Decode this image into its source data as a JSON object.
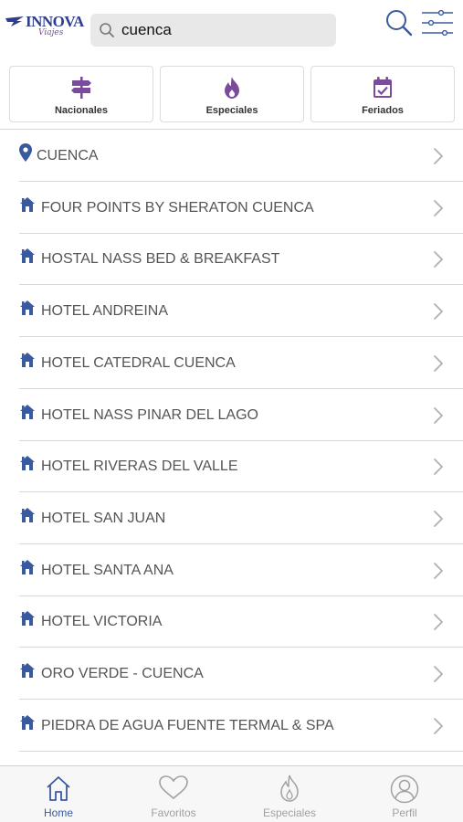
{
  "header": {
    "logo_text": "INNOVA",
    "logo_sub": "Viajes",
    "search_value": "cuenca"
  },
  "categories": [
    {
      "label": "Nacionales",
      "icon": "signpost-icon"
    },
    {
      "label": "Especiales",
      "icon": "flame-icon"
    },
    {
      "label": "Feriados",
      "icon": "calendar-check-icon"
    }
  ],
  "results": [
    {
      "label": "CUENCA",
      "icon": "location-pin-icon"
    },
    {
      "label": "FOUR POINTS BY SHERATON CUENCA",
      "icon": "hotel-icon"
    },
    {
      "label": "HOSTAL NASS BED & BREAKFAST",
      "icon": "hotel-icon"
    },
    {
      "label": "HOTEL ANDREINA",
      "icon": "hotel-icon"
    },
    {
      "label": "HOTEL CATEDRAL CUENCA",
      "icon": "hotel-icon"
    },
    {
      "label": "HOTEL NASS PINAR DEL LAGO",
      "icon": "hotel-icon"
    },
    {
      "label": "HOTEL RIVERAS DEL VALLE",
      "icon": "hotel-icon"
    },
    {
      "label": "HOTEL SAN JUAN",
      "icon": "hotel-icon"
    },
    {
      "label": "HOTEL SANTA ANA",
      "icon": "hotel-icon"
    },
    {
      "label": "HOTEL VICTORIA",
      "icon": "hotel-icon"
    },
    {
      "label": "ORO VERDE - CUENCA",
      "icon": "hotel-icon"
    },
    {
      "label": "PIEDRA DE AGUA FUENTE TERMAL & SPA",
      "icon": "hotel-icon"
    }
  ],
  "bottom_nav": [
    {
      "label": "Home",
      "icon": "home-icon",
      "active": true
    },
    {
      "label": "Favoritos",
      "icon": "heart-icon",
      "active": false
    },
    {
      "label": "Especiales",
      "icon": "flame-icon",
      "active": false
    },
    {
      "label": "Perfil",
      "icon": "user-icon",
      "active": false
    }
  ],
  "colors": {
    "accent_purple": "#7a4b9c",
    "icon_blue": "#3a5aa0",
    "brand_navy": "#2e3d8f"
  }
}
